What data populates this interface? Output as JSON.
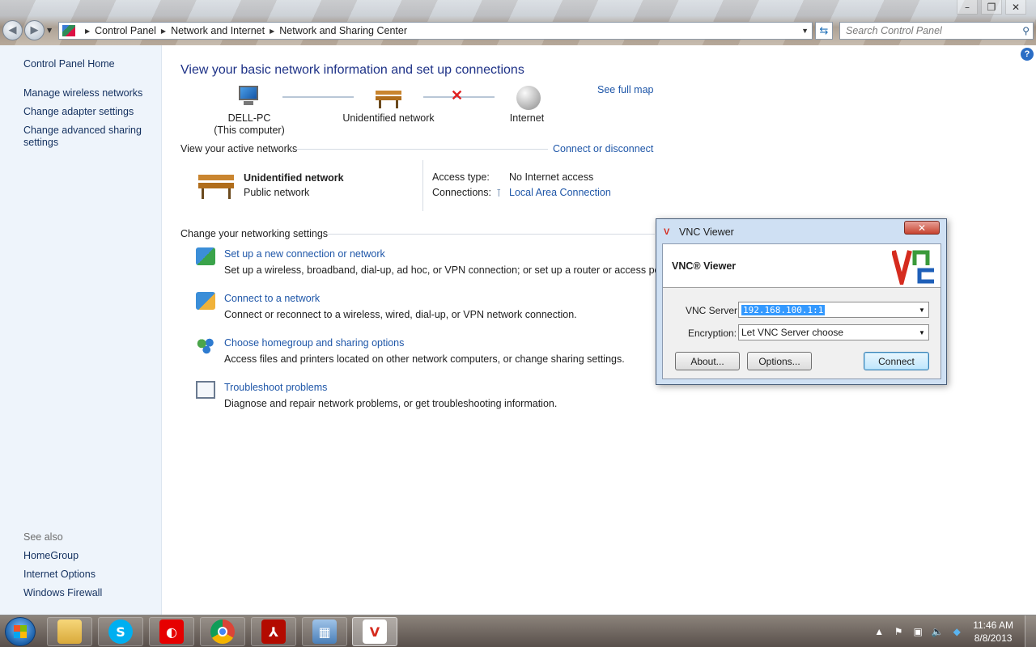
{
  "window": {
    "controls": [
      "–",
      "❐",
      "✕"
    ],
    "breadcrumb": [
      "Control Panel",
      "Network and Internet",
      "Network and Sharing Center"
    ],
    "search_placeholder": "Search Control Panel"
  },
  "sidebar": {
    "home": "Control Panel Home",
    "tasks": [
      "Manage wireless networks",
      "Change adapter settings",
      "Change advanced sharing settings"
    ],
    "see_also_label": "See also",
    "see_also": [
      "HomeGroup",
      "Internet Options",
      "Windows Firewall"
    ]
  },
  "main": {
    "heading": "View your basic network information and set up connections",
    "see_full_map": "See full map",
    "map": {
      "computer_name": "DELL-PC",
      "computer_sub": "(This computer)",
      "network": "Unidentified network",
      "internet": "Internet"
    },
    "active_networks_label": "View your active networks",
    "connect_or_disconnect": "Connect or disconnect",
    "active": {
      "name": "Unidentified network",
      "type": "Public network",
      "access_label": "Access type:",
      "access_value": "No Internet access",
      "connections_label": "Connections:",
      "connections_value": "Local Area Connection"
    },
    "change_settings_label": "Change your networking settings",
    "tasks": [
      {
        "title": "Set up a new connection or network",
        "desc": "Set up a wireless, broadband, dial-up, ad hoc, or VPN connection; or set up a router or access point."
      },
      {
        "title": "Connect to a network",
        "desc": "Connect or reconnect to a wireless, wired, dial-up, or VPN network connection."
      },
      {
        "title": "Choose homegroup and sharing options",
        "desc": "Access files and printers located on other network computers, or change sharing settings."
      },
      {
        "title": "Troubleshoot problems",
        "desc": "Diagnose and repair network problems, or get troubleshooting information."
      }
    ]
  },
  "vnc": {
    "title": "VNC Viewer",
    "header": "VNC® Viewer",
    "server_label": "VNC Server:",
    "server_value": "192.168.100.1:1",
    "encryption_label": "Encryption:",
    "encryption_value": "Let VNC Server choose",
    "about": "About...",
    "options": "Options...",
    "connect": "Connect"
  },
  "taskbar": {
    "time": "11:46 AM",
    "date": "8/8/2013"
  },
  "colors": {
    "link": "#1e56a8",
    "heading": "#1e3287",
    "sidebar_bg": "#eef4fb"
  }
}
